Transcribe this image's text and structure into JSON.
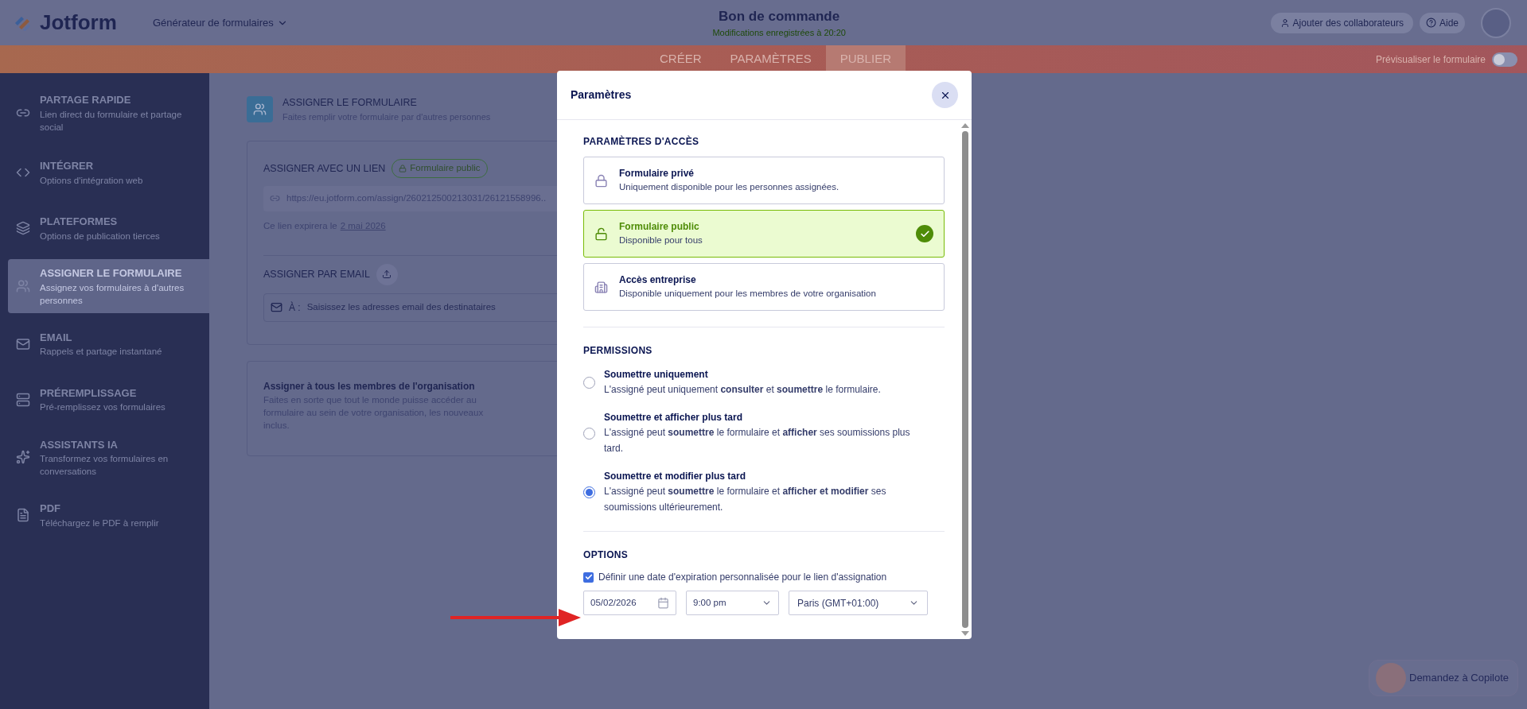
{
  "header": {
    "logo": "Jotform",
    "builder_menu": "Générateur de formulaires",
    "form_title": "Bon de commande",
    "save_status": "Modifications enregistrées à 20:20",
    "collaborators_button": "Ajouter des collaborateurs",
    "help_button": "Aide"
  },
  "tabs": [
    {
      "label": "CRÉER",
      "selected": false
    },
    {
      "label": "PARAMÈTRES",
      "selected": false
    },
    {
      "label": "PUBLIER",
      "selected": true
    }
  ],
  "preview": {
    "label": "Prévisualiser le formulaire",
    "on": false
  },
  "sidebar": {
    "items": [
      {
        "title": "PARTAGE RAPIDE",
        "subtitle": "Lien direct du formulaire et partage social",
        "selected": false
      },
      {
        "title": "INTÉGRER",
        "subtitle": "Options d'intégration web",
        "selected": false
      },
      {
        "title": "PLATEFORMES",
        "subtitle": "Options de publication tierces",
        "selected": false
      },
      {
        "title": "ASSIGNER LE FORMULAIRE",
        "subtitle": "Assignez vos formulaires à d'autres personnes",
        "selected": true
      },
      {
        "title": "EMAIL",
        "subtitle": "Rappels et partage instantané",
        "selected": false
      },
      {
        "title": "PRÉREMPLISSAGE",
        "subtitle": "Pré-remplissez vos formulaires",
        "selected": false
      },
      {
        "title": "ASSISTANTS IA",
        "subtitle": "Transformez vos formulaires en conversations",
        "selected": false
      },
      {
        "title": "PDF",
        "subtitle": "Téléchargez le PDF à remplir",
        "selected": false
      }
    ]
  },
  "main": {
    "title": "ASSIGNER LE FORMULAIRE",
    "subtitle": "Faites remplir votre formulaire par d'autres personnes",
    "link_section": {
      "heading": "ASSIGNER AVEC UN LIEN",
      "badge": "Formulaire public",
      "url": "https://eu.jotform.com/assign/260212500213031/26121558996..",
      "expiry_text": "Ce lien expirera le",
      "expiry_date": "2 mai 2026"
    },
    "email_section": {
      "heading": "ASSIGNER PAR EMAIL",
      "to_label": "À :",
      "placeholder": "Saisissez les adresses email des destinataires"
    },
    "org_section": {
      "title": "Assigner à tous les membres de l'organisation",
      "description": "Faites en sorte que tout le monde puisse accéder au formulaire au sein de votre organisation, les nouveaux inclus."
    }
  },
  "modal": {
    "title": "Paramètres",
    "access": {
      "heading": "PARAMÈTRES D'ACCÈS",
      "options": [
        {
          "title": "Formulaire privé",
          "description": "Uniquement disponible pour les personnes assignées.",
          "selected": false
        },
        {
          "title": "Formulaire public",
          "description": "Disponible pour tous",
          "selected": true
        },
        {
          "title": "Accès entreprise",
          "description": "Disponible uniquement pour les membres de votre organisation",
          "selected": false
        }
      ]
    },
    "permissions": {
      "heading": "PERMISSIONS",
      "options": [
        {
          "title": "Soumettre uniquement",
          "description": "L'assigné peut uniquement **consulter** et **soumettre** le formulaire.",
          "selected": false
        },
        {
          "title": "Soumettre et afficher plus tard",
          "description": "L'assigné peut **soumettre** le formulaire et **afficher** ses soumissions plus tard.",
          "selected": false
        },
        {
          "title": "Soumettre et modifier plus tard",
          "description": "L'assigné peut **soumettre** le formulaire et **afficher et modifier** ses soumissions ultérieurement.",
          "selected": true
        }
      ]
    },
    "options": {
      "heading": "OPTIONS",
      "expiry_checkbox": {
        "label": "Définir une date d'expiration personnalisée pour le lien d'assignation",
        "checked": true
      },
      "date": "05/02/2026",
      "time": "9:00 pm",
      "timezone": "Paris (GMT+01:00)"
    }
  },
  "copilot": {
    "label": "Demandez à Copilote"
  }
}
